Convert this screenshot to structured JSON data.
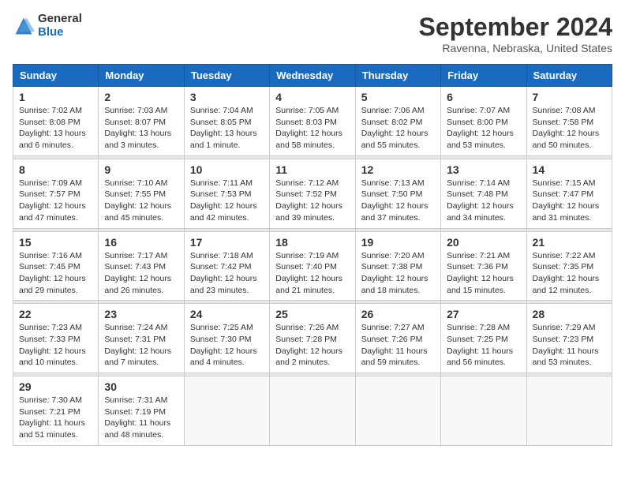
{
  "logo": {
    "general": "General",
    "blue": "Blue"
  },
  "title": "September 2024",
  "location": "Ravenna, Nebraska, United States",
  "days_header": [
    "Sunday",
    "Monday",
    "Tuesday",
    "Wednesday",
    "Thursday",
    "Friday",
    "Saturday"
  ],
  "weeks": [
    [
      {
        "day": "1",
        "info": "Sunrise: 7:02 AM\nSunset: 8:08 PM\nDaylight: 13 hours\nand 6 minutes."
      },
      {
        "day": "2",
        "info": "Sunrise: 7:03 AM\nSunset: 8:07 PM\nDaylight: 13 hours\nand 3 minutes."
      },
      {
        "day": "3",
        "info": "Sunrise: 7:04 AM\nSunset: 8:05 PM\nDaylight: 13 hours\nand 1 minute."
      },
      {
        "day": "4",
        "info": "Sunrise: 7:05 AM\nSunset: 8:03 PM\nDaylight: 12 hours\nand 58 minutes."
      },
      {
        "day": "5",
        "info": "Sunrise: 7:06 AM\nSunset: 8:02 PM\nDaylight: 12 hours\nand 55 minutes."
      },
      {
        "day": "6",
        "info": "Sunrise: 7:07 AM\nSunset: 8:00 PM\nDaylight: 12 hours\nand 53 minutes."
      },
      {
        "day": "7",
        "info": "Sunrise: 7:08 AM\nSunset: 7:58 PM\nDaylight: 12 hours\nand 50 minutes."
      }
    ],
    [
      {
        "day": "8",
        "info": "Sunrise: 7:09 AM\nSunset: 7:57 PM\nDaylight: 12 hours\nand 47 minutes."
      },
      {
        "day": "9",
        "info": "Sunrise: 7:10 AM\nSunset: 7:55 PM\nDaylight: 12 hours\nand 45 minutes."
      },
      {
        "day": "10",
        "info": "Sunrise: 7:11 AM\nSunset: 7:53 PM\nDaylight: 12 hours\nand 42 minutes."
      },
      {
        "day": "11",
        "info": "Sunrise: 7:12 AM\nSunset: 7:52 PM\nDaylight: 12 hours\nand 39 minutes."
      },
      {
        "day": "12",
        "info": "Sunrise: 7:13 AM\nSunset: 7:50 PM\nDaylight: 12 hours\nand 37 minutes."
      },
      {
        "day": "13",
        "info": "Sunrise: 7:14 AM\nSunset: 7:48 PM\nDaylight: 12 hours\nand 34 minutes."
      },
      {
        "day": "14",
        "info": "Sunrise: 7:15 AM\nSunset: 7:47 PM\nDaylight: 12 hours\nand 31 minutes."
      }
    ],
    [
      {
        "day": "15",
        "info": "Sunrise: 7:16 AM\nSunset: 7:45 PM\nDaylight: 12 hours\nand 29 minutes."
      },
      {
        "day": "16",
        "info": "Sunrise: 7:17 AM\nSunset: 7:43 PM\nDaylight: 12 hours\nand 26 minutes."
      },
      {
        "day": "17",
        "info": "Sunrise: 7:18 AM\nSunset: 7:42 PM\nDaylight: 12 hours\nand 23 minutes."
      },
      {
        "day": "18",
        "info": "Sunrise: 7:19 AM\nSunset: 7:40 PM\nDaylight: 12 hours\nand 21 minutes."
      },
      {
        "day": "19",
        "info": "Sunrise: 7:20 AM\nSunset: 7:38 PM\nDaylight: 12 hours\nand 18 minutes."
      },
      {
        "day": "20",
        "info": "Sunrise: 7:21 AM\nSunset: 7:36 PM\nDaylight: 12 hours\nand 15 minutes."
      },
      {
        "day": "21",
        "info": "Sunrise: 7:22 AM\nSunset: 7:35 PM\nDaylight: 12 hours\nand 12 minutes."
      }
    ],
    [
      {
        "day": "22",
        "info": "Sunrise: 7:23 AM\nSunset: 7:33 PM\nDaylight: 12 hours\nand 10 minutes."
      },
      {
        "day": "23",
        "info": "Sunrise: 7:24 AM\nSunset: 7:31 PM\nDaylight: 12 hours\nand 7 minutes."
      },
      {
        "day": "24",
        "info": "Sunrise: 7:25 AM\nSunset: 7:30 PM\nDaylight: 12 hours\nand 4 minutes."
      },
      {
        "day": "25",
        "info": "Sunrise: 7:26 AM\nSunset: 7:28 PM\nDaylight: 12 hours\nand 2 minutes."
      },
      {
        "day": "26",
        "info": "Sunrise: 7:27 AM\nSunset: 7:26 PM\nDaylight: 11 hours\nand 59 minutes."
      },
      {
        "day": "27",
        "info": "Sunrise: 7:28 AM\nSunset: 7:25 PM\nDaylight: 11 hours\nand 56 minutes."
      },
      {
        "day": "28",
        "info": "Sunrise: 7:29 AM\nSunset: 7:23 PM\nDaylight: 11 hours\nand 53 minutes."
      }
    ],
    [
      {
        "day": "29",
        "info": "Sunrise: 7:30 AM\nSunset: 7:21 PM\nDaylight: 11 hours\nand 51 minutes."
      },
      {
        "day": "30",
        "info": "Sunrise: 7:31 AM\nSunset: 7:19 PM\nDaylight: 11 hours\nand 48 minutes."
      },
      {
        "day": "",
        "info": ""
      },
      {
        "day": "",
        "info": ""
      },
      {
        "day": "",
        "info": ""
      },
      {
        "day": "",
        "info": ""
      },
      {
        "day": "",
        "info": ""
      }
    ]
  ]
}
